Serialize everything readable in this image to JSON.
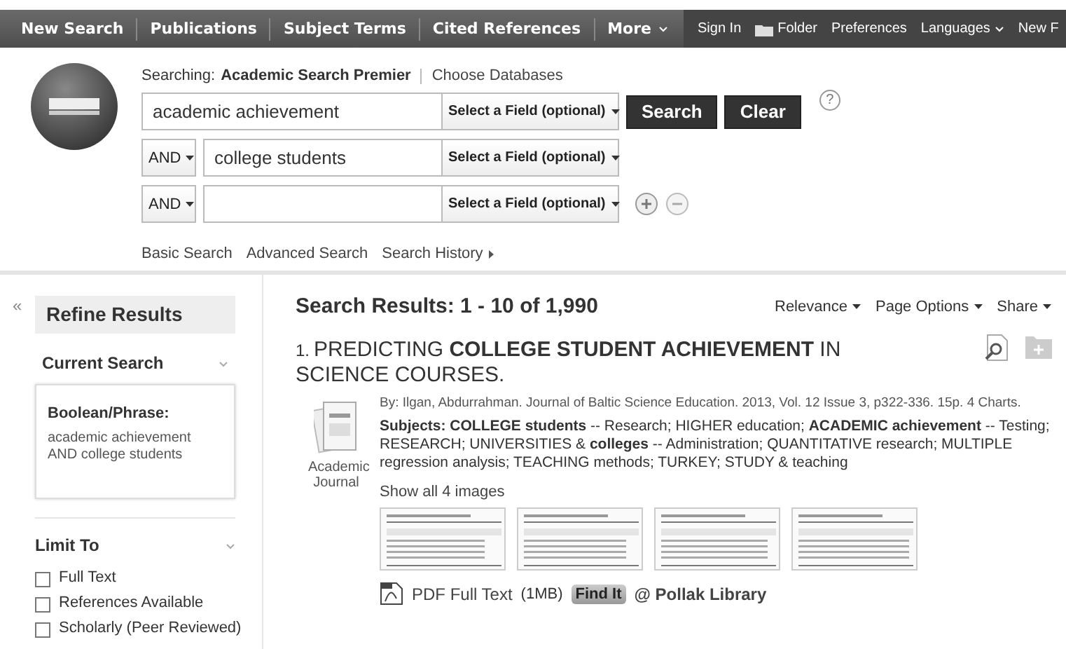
{
  "top_nav": {
    "items": [
      {
        "label": "New Search",
        "kind": "link"
      },
      {
        "label": "Publications",
        "kind": "link"
      },
      {
        "label": "Subject Terms",
        "kind": "link"
      },
      {
        "label": "Cited References",
        "kind": "link"
      },
      {
        "label": "More",
        "kind": "dropdown"
      }
    ],
    "user_links": [
      {
        "label": "Sign In",
        "kind": "link"
      },
      {
        "label": "Folder",
        "kind": "folder"
      },
      {
        "label": "Preferences",
        "kind": "link"
      },
      {
        "label": "Languages",
        "kind": "dropdown"
      },
      {
        "label": "New F",
        "kind": "link"
      }
    ]
  },
  "search": {
    "searching_label": "Searching:",
    "database": "Academic Search Premier",
    "choose_link": "Choose Databases",
    "rows": [
      {
        "value": "academic achievement",
        "field": "Select a Field (optional)"
      },
      {
        "operator": "AND",
        "value": "college students",
        "field": "Select a Field (optional)"
      },
      {
        "operator": "AND",
        "field": "Select a Field (optional)"
      }
    ],
    "search_button": "Search",
    "clear_button": "Clear",
    "help": "?",
    "links": [
      {
        "label": "Basic Search",
        "kind": "link"
      },
      {
        "label": "Advanced Search",
        "kind": "link"
      },
      {
        "label": "Search History",
        "kind": "menu"
      }
    ]
  },
  "sidebar": {
    "collapse": "«",
    "title": "Refine Results",
    "current_search": {
      "title": "Current Search",
      "mode": "Boolean/Phrase:",
      "query": "academic achievement AND college students"
    },
    "limit_to": {
      "title": "Limit To",
      "options": [
        {
          "label": "Full Text",
          "checked": false
        },
        {
          "label": "References Available",
          "checked": false
        },
        {
          "label": "Scholarly (Peer Reviewed)",
          "checked": false
        }
      ]
    }
  },
  "results": {
    "heading": "Search Results: 1 - 10 of 1,990",
    "controls": [
      "Relevance",
      "Page Options",
      "Share"
    ],
    "items": [
      {
        "number": "1.",
        "title": "PREDICTING **COLLEGE STUDENT ACHIEVEMENT** IN SCIENCE COURSES.",
        "byline": "By: Ilgan, Abdurrahman. Journal of Baltic Science Education. 2013, Vol. 12 Issue 3, p322-336. 15p. 4 Charts.",
        "subjects": "**Subjects: COLLEGE students** -- Research; HIGHER education; **ACADEMIC achievement** -- Testing; RESEARCH; UNIVERSITIES & **colleges** -- Administration; QUANTITATIVE research; MULTIPLE regression analysis; TEACHING methods; TURKEY; STUDY & teaching",
        "type": "Academic Journal",
        "show_images": "Show all 4 images",
        "pdf_link": "PDF Full Text",
        "pdf_size": "(1MB)",
        "find_it": "Find It",
        "library": "@ Pollak Library"
      }
    ]
  }
}
